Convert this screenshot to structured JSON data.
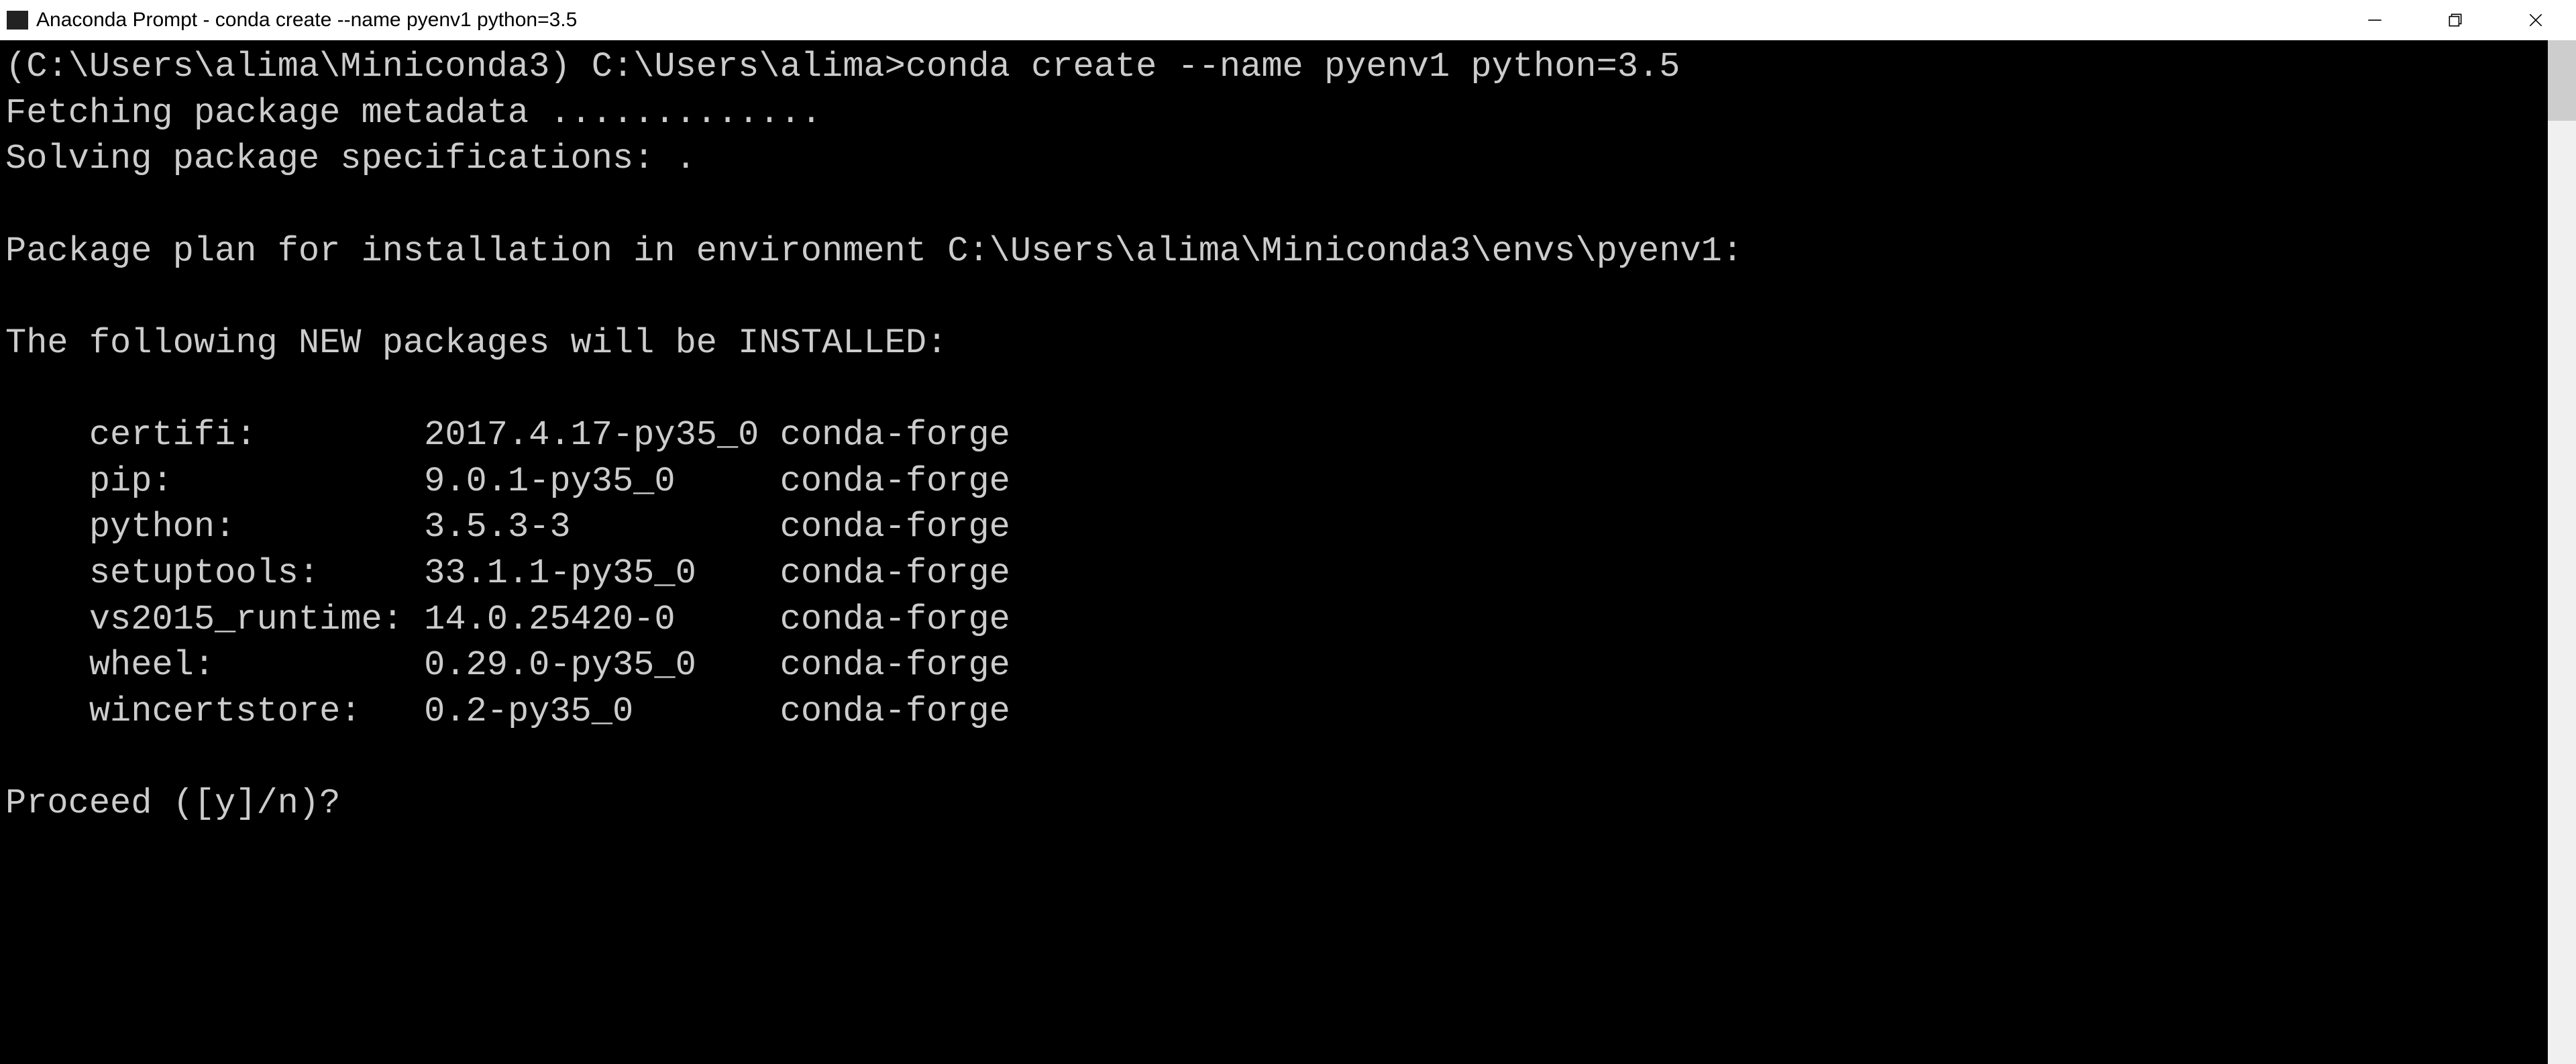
{
  "window": {
    "title": "Anaconda Prompt - conda  create --name pyenv1 python=3.5"
  },
  "terminal": {
    "prompt_env": "(C:\\Users\\alima\\Miniconda3)",
    "prompt_path": "C:\\Users\\alima>",
    "command": "conda create --name pyenv1 python=3.5",
    "fetching_line": "Fetching package metadata .............",
    "solving_line": "Solving package specifications: .",
    "plan_line": "Package plan for installation in environment C:\\Users\\alima\\Miniconda3\\envs\\pyenv1:",
    "installed_header": "The following NEW packages will be INSTALLED:",
    "packages": [
      {
        "name": "certifi:",
        "version": "2017.4.17-py35_0",
        "channel": "conda-forge"
      },
      {
        "name": "pip:",
        "version": "9.0.1-py35_0",
        "channel": "conda-forge"
      },
      {
        "name": "python:",
        "version": "3.5.3-3",
        "channel": "conda-forge"
      },
      {
        "name": "setuptools:",
        "version": "33.1.1-py35_0",
        "channel": "conda-forge"
      },
      {
        "name": "vs2015_runtime:",
        "version": "14.0.25420-0",
        "channel": "conda-forge"
      },
      {
        "name": "wheel:",
        "version": "0.29.0-py35_0",
        "channel": "conda-forge"
      },
      {
        "name": "wincertstore:",
        "version": "0.2-py35_0",
        "channel": "conda-forge"
      }
    ],
    "proceed_prompt": "Proceed ([y]/n)?"
  }
}
